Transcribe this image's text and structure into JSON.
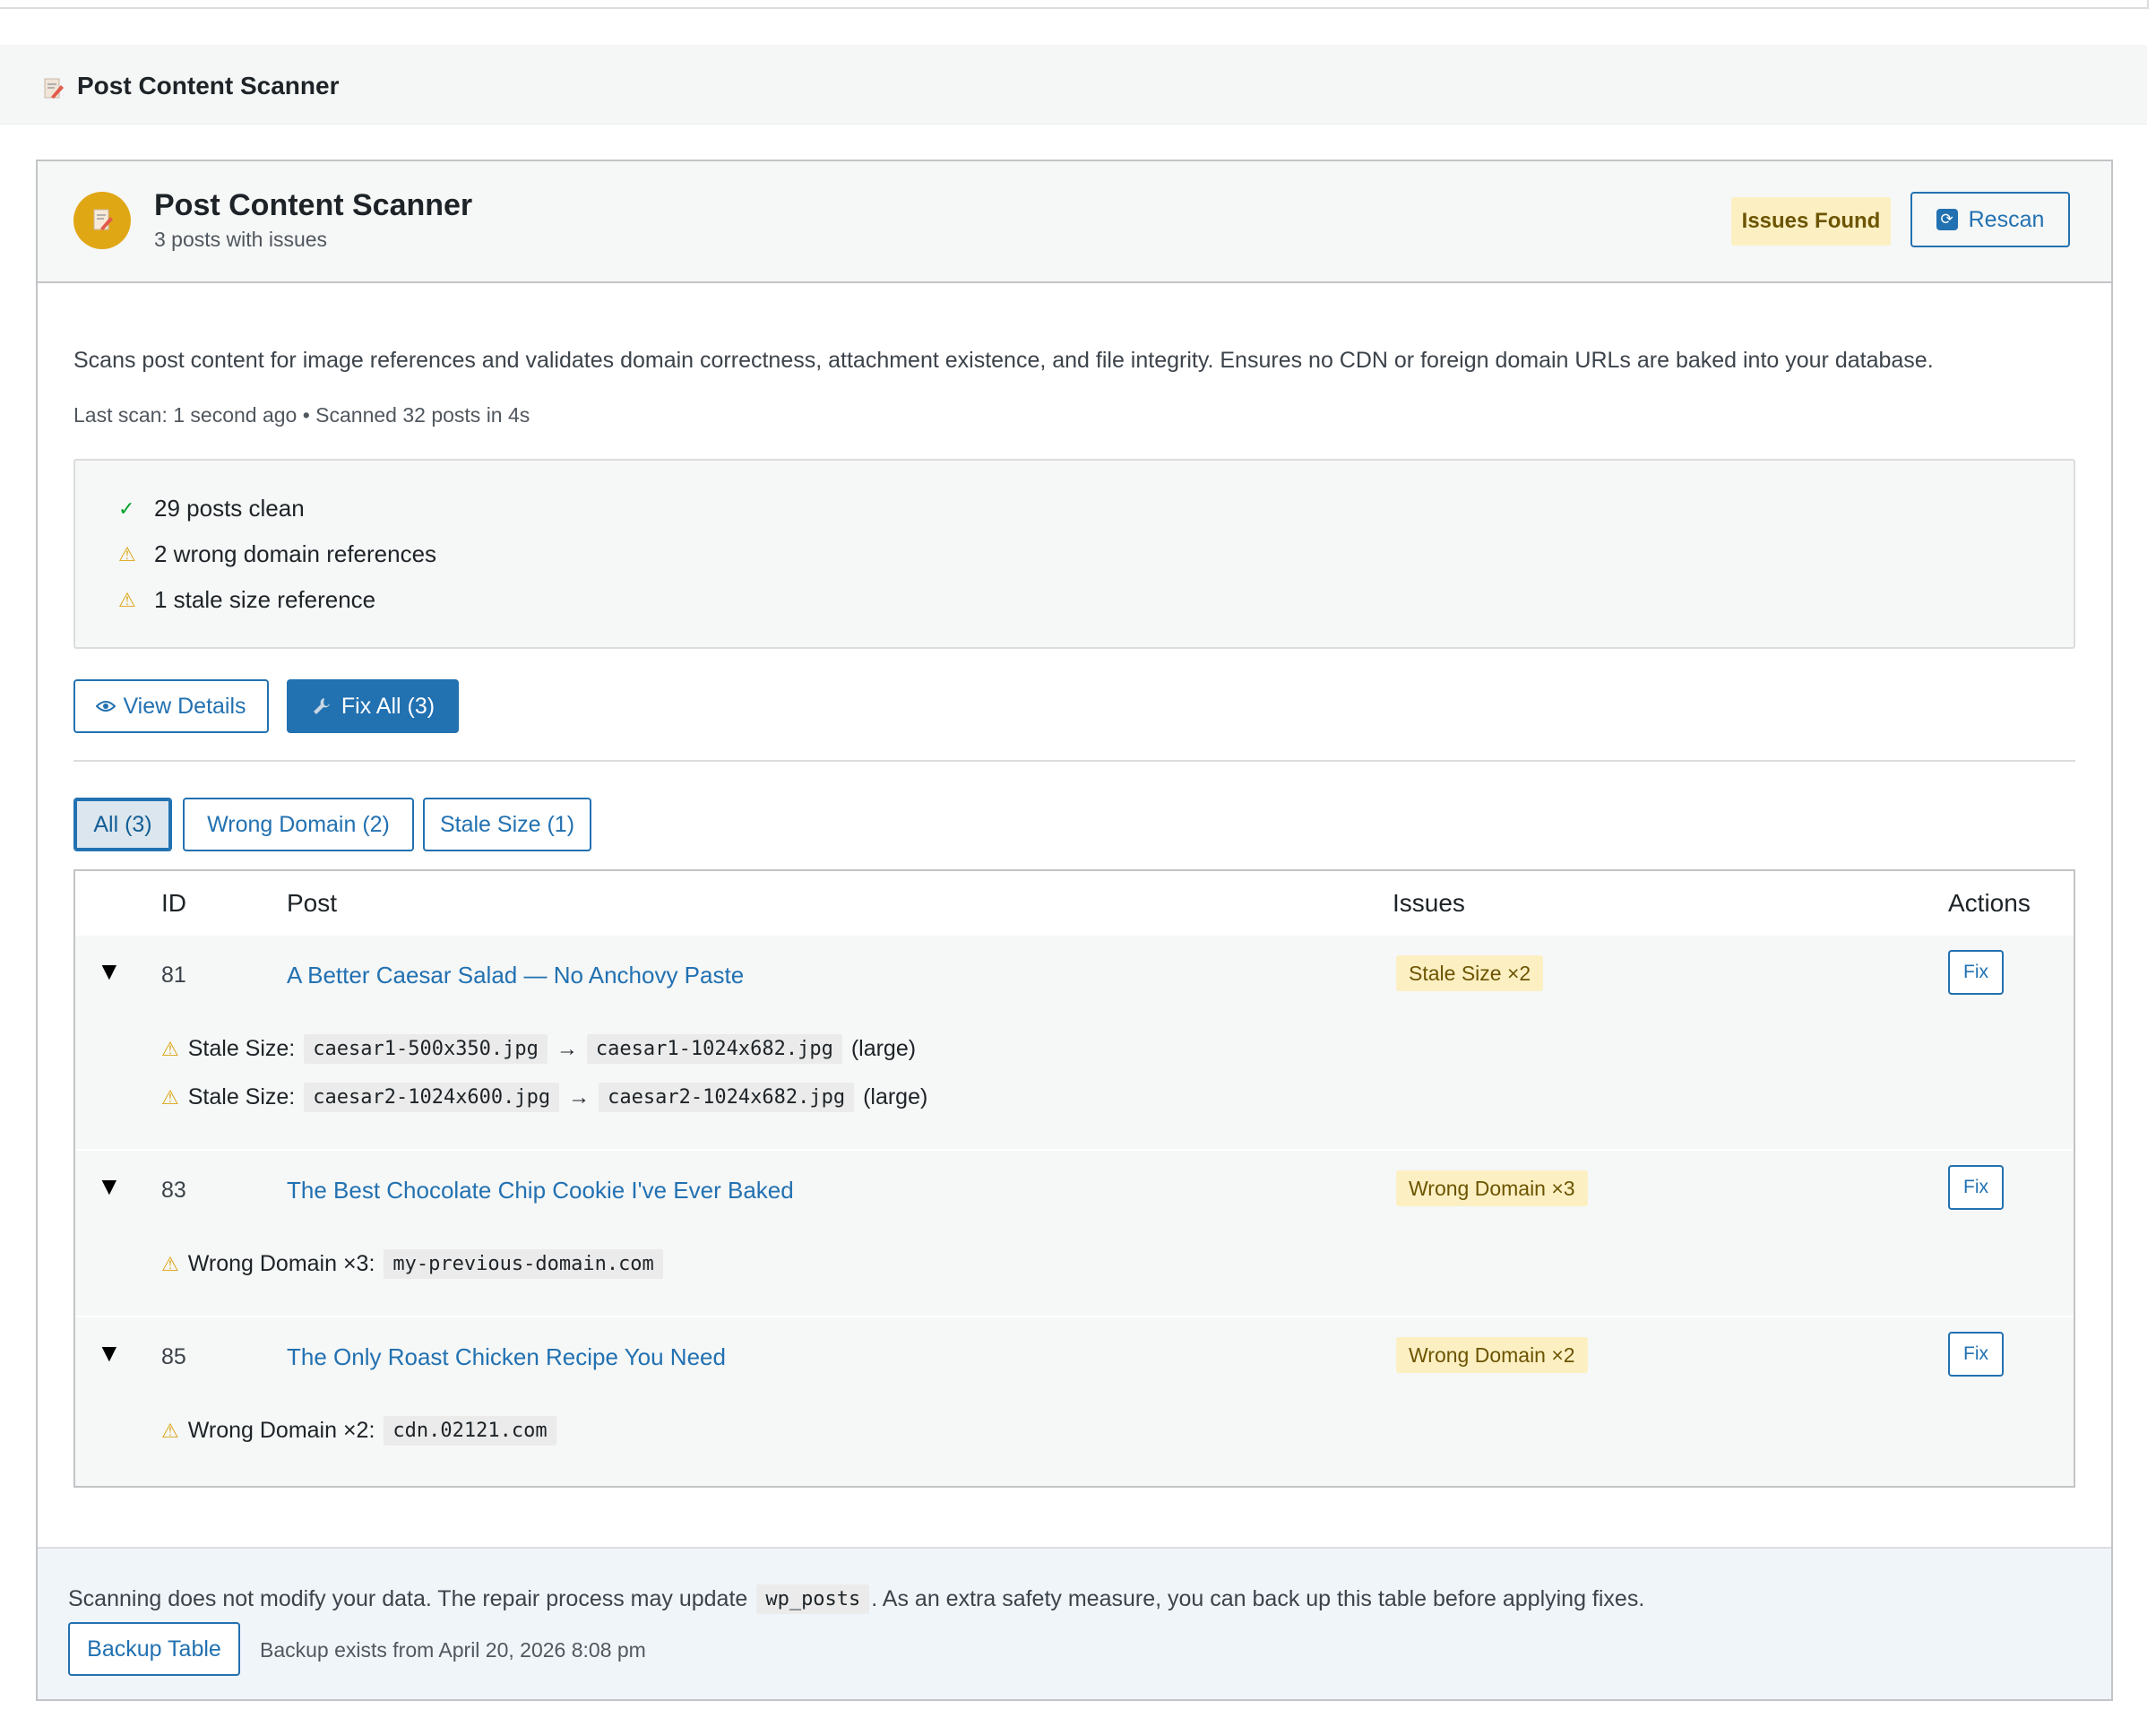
{
  "page": {
    "title": "Post Content Scanner"
  },
  "card": {
    "title": "Post Content Scanner",
    "subtitle": "3 posts with issues",
    "status_badge": "Issues Found",
    "rescan_label": "Rescan",
    "description": "Scans post content for image references and validates domain correctness, attachment existence, and file integrity. Ensures no CDN or foreign domain URLs are baked into your database.",
    "last_scan": "Last scan: 1 second ago • Scanned 32 posts in 4s"
  },
  "summary": {
    "items": [
      {
        "icon": "✓",
        "text": "29 posts clean",
        "type": "ok"
      },
      {
        "icon": "⚠",
        "text": "2 wrong domain references",
        "type": "warn"
      },
      {
        "icon": "⚠",
        "text": "1 stale size reference",
        "type": "warn"
      }
    ]
  },
  "actions": {
    "view_details": "View Details",
    "fix_all": "Fix All (3)"
  },
  "filters": [
    {
      "label": "All (3)",
      "active": true
    },
    {
      "label": "Wrong Domain (2)",
      "active": false
    },
    {
      "label": "Stale Size (1)",
      "active": false
    }
  ],
  "table": {
    "headers": {
      "id": "ID",
      "post": "Post",
      "issues": "Issues",
      "actions": "Actions"
    },
    "rows": [
      {
        "toggle": "▼",
        "id": "81",
        "post": "A Better Caesar Salad — No Anchovy Paste",
        "badge": "Stale Size ×2",
        "fix": "Fix",
        "details": [
          {
            "label": "Stale Size:",
            "from": "caesar1-500x350.jpg",
            "arrow": "→",
            "to": "caesar1-1024x682.jpg",
            "suffix": "(large)"
          },
          {
            "label": "Stale Size:",
            "from": "caesar2-1024x600.jpg",
            "arrow": "→",
            "to": "caesar2-1024x682.jpg",
            "suffix": "(large)"
          }
        ]
      },
      {
        "toggle": "▼",
        "id": "83",
        "post": "The Best Chocolate Chip Cookie I've Ever Baked",
        "badge": "Wrong Domain ×3",
        "fix": "Fix",
        "details": [
          {
            "label": "Wrong Domain ×3:",
            "domain": "my-previous-domain.com"
          }
        ]
      },
      {
        "toggle": "▼",
        "id": "85",
        "post": "The Only Roast Chicken Recipe You Need",
        "badge": "Wrong Domain ×2",
        "fix": "Fix",
        "details": [
          {
            "label": "Wrong Domain ×2:",
            "domain": "cdn.02121.com"
          }
        ]
      }
    ]
  },
  "footer": {
    "note_before": "Scanning does not modify your data. The repair process may update",
    "note_code": "wp_posts",
    "note_after": ". As an extra safety measure, you can back up this table before applying fixes.",
    "backup_label": "Backup Table",
    "backup_status": "Backup exists from April 20, 2026 8:08 pm"
  },
  "icons": {
    "document": "document-icon",
    "check": "check-icon",
    "warning": "warning-icon",
    "eye": "eye-icon",
    "wrench": "wrench-icon",
    "refresh": "refresh-icon",
    "triangle": "triangle-down-icon"
  },
  "colors": {
    "accent": "#2271b1",
    "warning_bg": "#fcf0c3",
    "warning_text": "#6c5400",
    "icon_bg": "#e0a714",
    "ok": "#00a32a"
  }
}
